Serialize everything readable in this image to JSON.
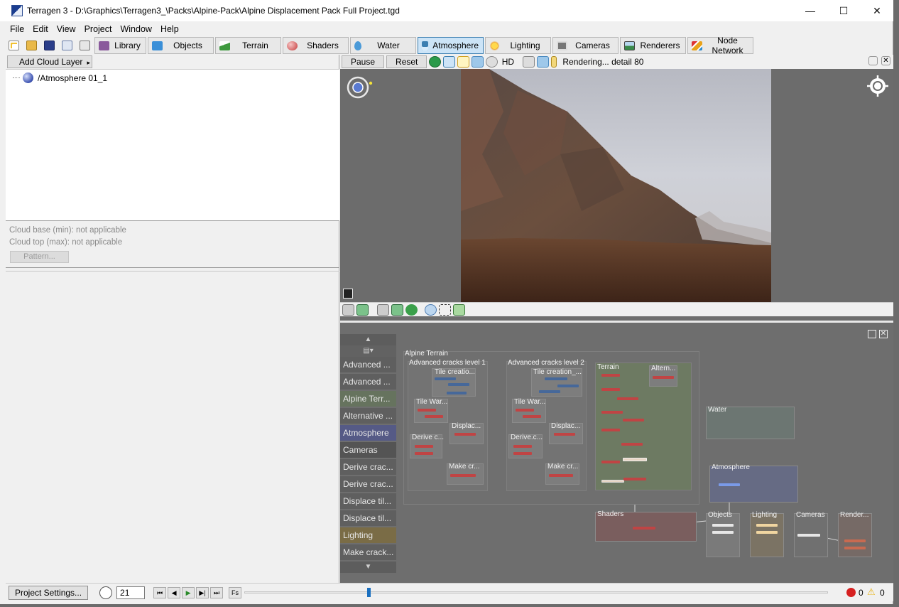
{
  "window": {
    "title": "Terragen 3 - D:\\Graphics\\Terragen3_\\Packs\\Alpine-Pack\\Alpine Displacement Pack Full Project.tgd",
    "minimize": "—",
    "maximize": "☐",
    "close": "✕"
  },
  "menu": [
    "File",
    "Edit",
    "View",
    "Project",
    "Window",
    "Help"
  ],
  "toolbar": {
    "tabs": [
      {
        "label": "Library",
        "icon": "library-icon",
        "color": "#8a5a9c"
      },
      {
        "label": "Objects",
        "icon": "cube-icon",
        "color": "#3a8fd8"
      },
      {
        "label": "Terrain",
        "icon": "terrain-icon",
        "color": "#3f9a3f"
      },
      {
        "label": "Shaders",
        "icon": "sphere-icon",
        "color": "#d14b4b"
      },
      {
        "label": "Water",
        "icon": "water-drop-icon",
        "color": "#4a9ad8"
      },
      {
        "label": "Atmosphere",
        "icon": "cloud-icon",
        "color": "#3c7fb1"
      },
      {
        "label": "Lighting",
        "icon": "sun-icon",
        "color": "#e8a21a"
      },
      {
        "label": "Cameras",
        "icon": "camera-icon",
        "color": "#6a6a6a"
      },
      {
        "label": "Renderers",
        "icon": "image-icon",
        "color": "#3a8a4a"
      },
      {
        "label": "Node Network",
        "icon": "node-network-icon",
        "color": "#d08a20"
      }
    ],
    "active_tab": "Atmosphere"
  },
  "left": {
    "add_cloud_label": "Add Cloud Layer",
    "tree_item": "/Atmosphere 01_1",
    "cloud_base": "Cloud base (min): not applicable",
    "cloud_top": "Cloud top (max): not applicable",
    "pattern_label": "Pattern..."
  },
  "render": {
    "pause": "Pause",
    "reset": "Reset",
    "hd": "HD",
    "status": "Rendering... detail 80"
  },
  "node_list": {
    "items": [
      {
        "label": "Advanced ...",
        "color": "#5f5f5f"
      },
      {
        "label": "Advanced ...",
        "color": "#5f5f5f"
      },
      {
        "label": "Alpine Terr...",
        "color": "#66735e"
      },
      {
        "label": "Alternative ...",
        "color": "#5f5f5f"
      },
      {
        "label": "Atmosphere",
        "color": "#555a86"
      },
      {
        "label": "Cameras",
        "color": "#545454"
      },
      {
        "label": "Derive crac...",
        "color": "#5f5f5f"
      },
      {
        "label": "Derive crac...",
        "color": "#5f5f5f"
      },
      {
        "label": "Displace til...",
        "color": "#5f5f5f"
      },
      {
        "label": "Displace til...",
        "color": "#5f5f5f"
      },
      {
        "label": "Lighting",
        "color": "#7a6c46"
      },
      {
        "label": "Make crack...",
        "color": "#5f5f5f"
      }
    ]
  },
  "graph": {
    "alpine_terrain": "Alpine Terrain",
    "cracks1": "Advanced cracks level 1",
    "cracks2": "Advanced cracks level 2",
    "terrain": "Terrain",
    "altern": "Altern...",
    "tile_creation": "Tile creatio...",
    "tile_creation2": "Tile creation_...",
    "tile_war": "Tile War...",
    "displac": "Displac...",
    "derive": "Derive c...",
    "derive2": "Derive.c...",
    "make": "Make cr...",
    "water": "Water",
    "atmosphere": "Atmosphere",
    "shaders": "Shaders",
    "objects": "Objects",
    "lighting": "Lighting",
    "cameras": "Cameras",
    "renderers": "Render..."
  },
  "status": {
    "project_settings": "Project Settings...",
    "frame": "21",
    "errors": "0",
    "warnings": "0",
    "timeline_progress": 0.21
  }
}
